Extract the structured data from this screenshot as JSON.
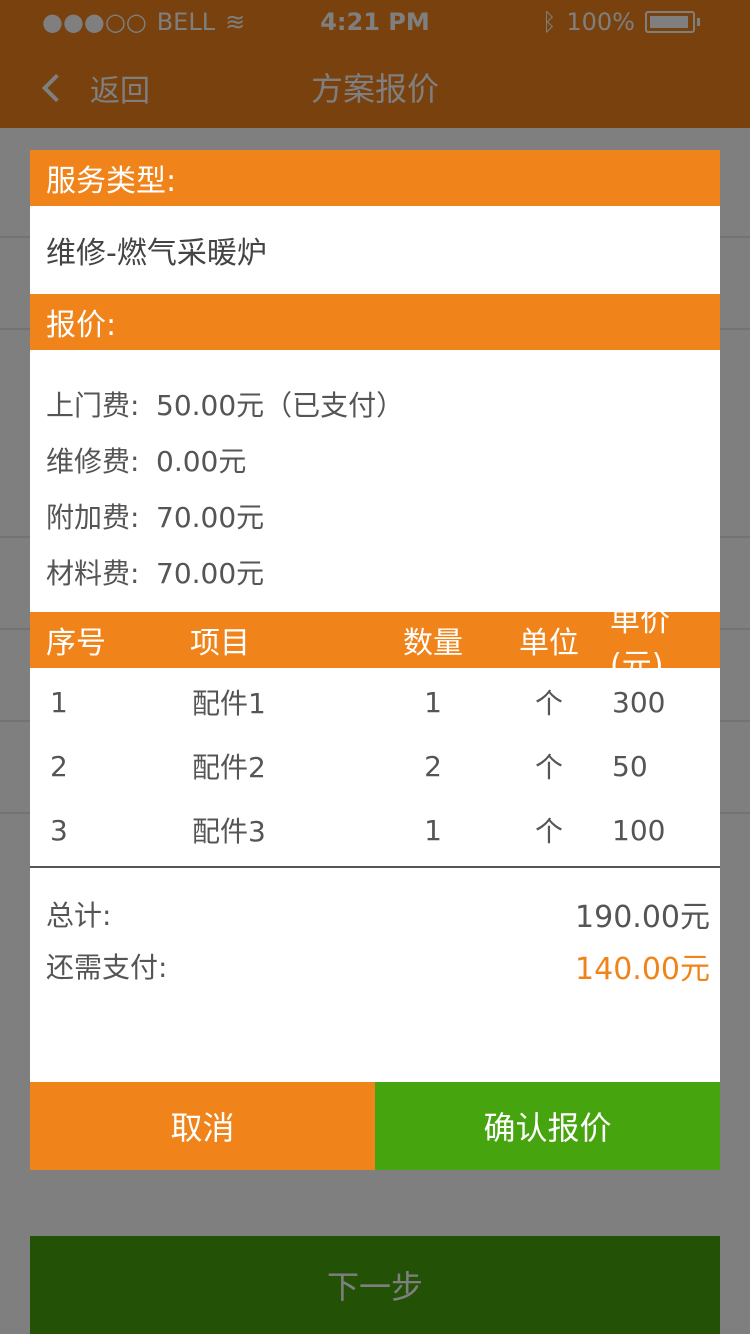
{
  "statusbar": {
    "carrier": "BELL",
    "time": "4:21 PM",
    "battery": "100%"
  },
  "nav": {
    "back_label": "返回",
    "title": "方案报价"
  },
  "background_page": {
    "next_button": "下一步"
  },
  "modal": {
    "service_type_header": "服务类型:",
    "service_type_value": "维修-燃气采暖炉",
    "quote_header": "报价:",
    "fees": [
      {
        "label": "上门费:",
        "value": "50.00元（已支付）"
      },
      {
        "label": "维修费:",
        "value": "0.00元"
      },
      {
        "label": "附加费:",
        "value": "70.00元"
      },
      {
        "label": "材料费:",
        "value": "70.00元"
      }
    ],
    "table": {
      "headers": [
        "序号",
        "项目",
        "数量",
        "单位",
        "单价(元)"
      ],
      "rows": [
        [
          "1",
          "配件1",
          "1",
          "个",
          "300"
        ],
        [
          "2",
          "配件2",
          "2",
          "个",
          "50"
        ],
        [
          "3",
          "配件3",
          "1",
          "个",
          "100"
        ]
      ]
    },
    "totals": {
      "total_label": "总计:",
      "total_value": "190.00元",
      "due_label": "还需支付:",
      "due_value": "140.00元"
    },
    "actions": {
      "cancel": "取消",
      "confirm": "确认报价"
    }
  },
  "colors": {
    "accent_orange": "#f0831a",
    "accent_green": "#46a40f"
  }
}
